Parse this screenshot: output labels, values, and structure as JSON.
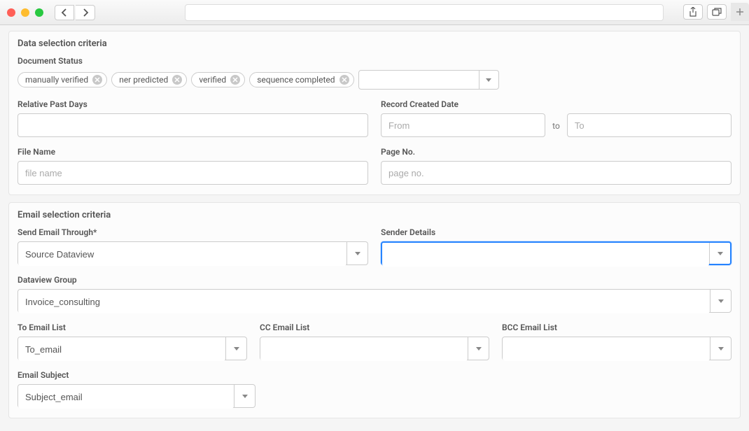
{
  "sections": {
    "data_selection": {
      "title": "Data selection criteria"
    },
    "email_selection": {
      "title": "Email selection criteria"
    }
  },
  "document_status": {
    "label": "Document Status",
    "tokens": [
      "manually verified",
      "ner predicted",
      "verified",
      "sequence completed"
    ]
  },
  "relative_past_days": {
    "label": "Relative Past Days",
    "value": ""
  },
  "record_created_date": {
    "label": "Record Created Date",
    "from_placeholder": "From",
    "to_text": "to",
    "to_placeholder": "To"
  },
  "file_name": {
    "label": "File Name",
    "placeholder": "file name"
  },
  "page_no": {
    "label": "Page No.",
    "placeholder": "page no."
  },
  "send_email_through": {
    "label": "Send Email Through",
    "required": "*",
    "value": "Source Dataview"
  },
  "sender_details": {
    "label": "Sender Details",
    "value": ""
  },
  "dataview_group": {
    "label": "Dataview Group",
    "value": "Invoice_consulting"
  },
  "to_email": {
    "label": "To Email List",
    "value": "To_email"
  },
  "cc_email": {
    "label": "CC Email List",
    "value": ""
  },
  "bcc_email": {
    "label": "BCC Email List",
    "value": ""
  },
  "email_subject": {
    "label": "Email Subject",
    "value": "Subject_email"
  }
}
